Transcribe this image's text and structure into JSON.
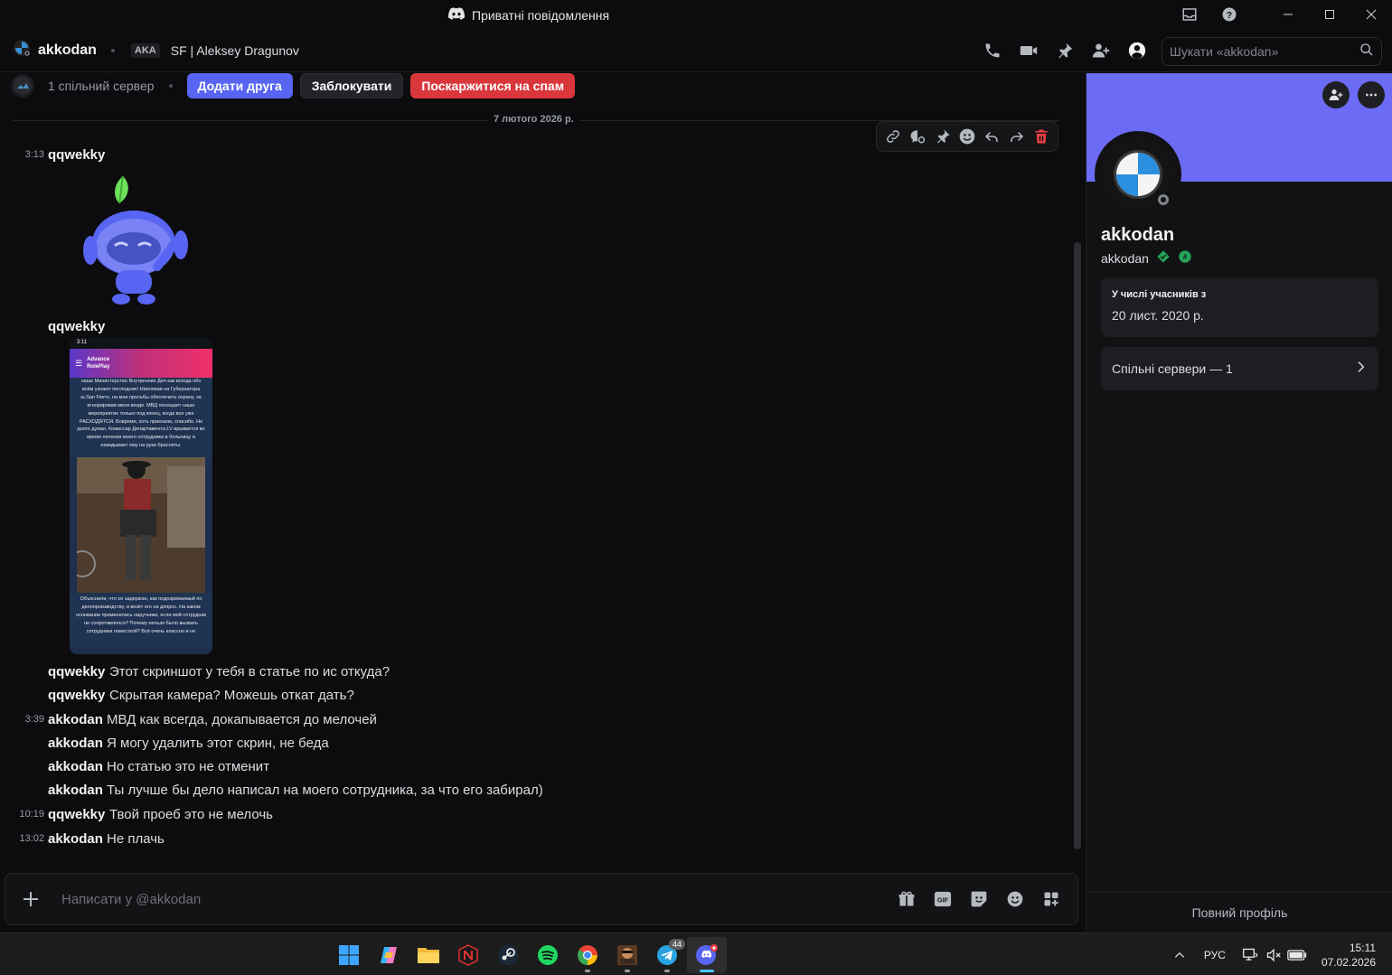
{
  "window": {
    "title": "Приватні повідомлення"
  },
  "header": {
    "username": "akkodan",
    "aka_label": "AKA",
    "aka_name": "SF | Aleksey Dragunov",
    "search_placeholder": "Шукати «akkodan»"
  },
  "friend_bar": {
    "mutual_servers": "1 спільний сервер",
    "add_friend": "Додати друга",
    "block": "Заблокувати",
    "report_spam": "Поскаржитися на спам"
  },
  "date_divider": "7 лютого 2026 р.",
  "messages": [
    {
      "time": "3:13",
      "author": "qqwekky",
      "text": ""
    },
    {
      "time": "",
      "author": "qqwekky",
      "text": ""
    },
    {
      "time": "",
      "author": "qqwekky",
      "text": "Этот скриншот у тебя в статье по ис откуда?"
    },
    {
      "time": "",
      "author": "qqwekky",
      "text": "Скрытая камера? Можешь откат дать?"
    },
    {
      "time": "3:39",
      "author": "akkodan",
      "text": "МВД как всегда, докапывается до мелочей"
    },
    {
      "time": "",
      "author": "akkodan",
      "text": "Я могу удалить этот скрин, не беда"
    },
    {
      "time": "",
      "author": "akkodan",
      "text": "Но статью это не отменит"
    },
    {
      "time": "",
      "author": "akkodan",
      "text": "Ты лучше бы дело написал на моего сотрудника, за что его забирал)"
    },
    {
      "time": "10:19",
      "author": "qqwekky",
      "text": "Твой проеб это не мелочь"
    },
    {
      "time": "13:02",
      "author": "akkodan",
      "text": "Не плачь"
    }
  ],
  "screenshot_attachment": {
    "status_time": "3:11",
    "app_name_line1": "Advance",
    "app_name_line2": "RolePlay",
    "text_top": "наше Министерство Внутренних Дел как всегда обо всём узнают последние! Наплевав на Губернатора ш.San Fierro, на мои просьбы обеспечить охрану, за игнорировав меня везде. МВД посещает наше мероприятие только под конец, когда все уже РАСХОДЯТСЯ. Вовремя, хоть приехали, спасибо. Не долго думая, Комиссар Департамента LV врывается во время лечения моего сотрудника в больницу и накидывает ему на руки браслеты.",
    "text_bottom": "Объяснили, что он задержан, как подозреваемый по делопроизводству, и везёт его на допрос. На каком основании применялись наручники, если мой сотрудник не сопротивлялся? Почему нельзя было вызвать сотрудника повесткой? Всё очень классно и не"
  },
  "composer": {
    "placeholder": "Написати у @akkodan"
  },
  "profile": {
    "display_name": "akkodan",
    "username": "akkodan",
    "member_since_label": "У числі учасників з",
    "member_since_value": "20 лист. 2020 р.",
    "mutual_servers": "Спільні сервери — 1",
    "full_profile": "Повний профіль",
    "banner_color": "#6b6bf5"
  },
  "taskbar": {
    "telegram_badge": "44",
    "language": "РУС",
    "time": "15:11",
    "date": "07.02.2026"
  },
  "colors": {
    "blurple": "#5865f2",
    "danger": "#da373c",
    "background": "#0c0c0e"
  }
}
